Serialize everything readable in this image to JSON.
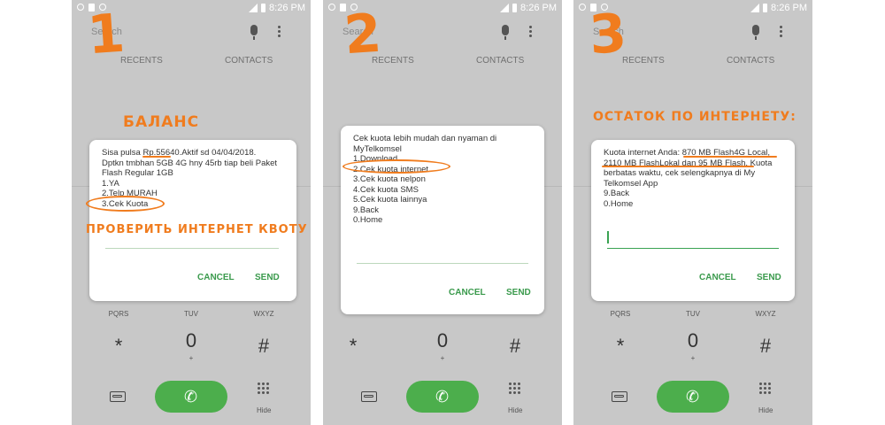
{
  "status_time": "8:26 PM",
  "search_placeholder": "Search",
  "tabs": {
    "recents": "RECENTS",
    "contacts": "CONTACTS"
  },
  "buttons": {
    "cancel": "CANCEL",
    "send": "SEND"
  },
  "keypad": {
    "row_letters": [
      "PQRS",
      "TUV",
      "WXYZ"
    ],
    "star": "*",
    "zero": "0",
    "plus": "+",
    "hash": "#",
    "hide": "Hide"
  },
  "colors": {
    "accent": "#f07c1e",
    "call_green": "#4cae4c",
    "dialog_button": "#3a9a4c",
    "background": "#c8c8c8"
  },
  "icons": [
    "mic-icon",
    "more-icon",
    "voicemail-icon",
    "phone-icon",
    "keypad-icon"
  ],
  "panels": [
    {
      "step": "1",
      "annotation_top": "БАЛАНС",
      "annotation_mid": "ПРОВЕРИТЬ ИНТЕРНЕТ КВОТУ",
      "lines": [
        "Sisa pulsa Rp.55640.Aktif sd 04/04/2018.",
        "Dptkn tmbhan 5GB 4G hny 45rb tiap beli Paket",
        "Flash Regular 1GB",
        "1.YA",
        "2.Telp MURAH",
        "3.Cek Kuota"
      ]
    },
    {
      "step": "2",
      "lines": [
        "Cek kuota lebih mudah dan nyaman di",
        "MyTelkomsel",
        "1.Download",
        "2.Cek kuota internet",
        "3.Cek kuota nelpon",
        "4.Cek kuota SMS",
        "5.Cek kuota lainnya",
        "9.Back",
        "0.Home"
      ]
    },
    {
      "step": "3",
      "annotation_top": "ОСТАТОК ПО ИНТЕРНЕТУ:",
      "lines": [
        "Kuota internet Anda: 870 MB Flash4G Local,",
        "2110 MB FlashLokal dan 95 MB Flash. Kuota",
        "berbatas waktu, cek selengkapnya di My",
        "Telkomsel App",
        "9.Back",
        "0.Home"
      ]
    }
  ]
}
